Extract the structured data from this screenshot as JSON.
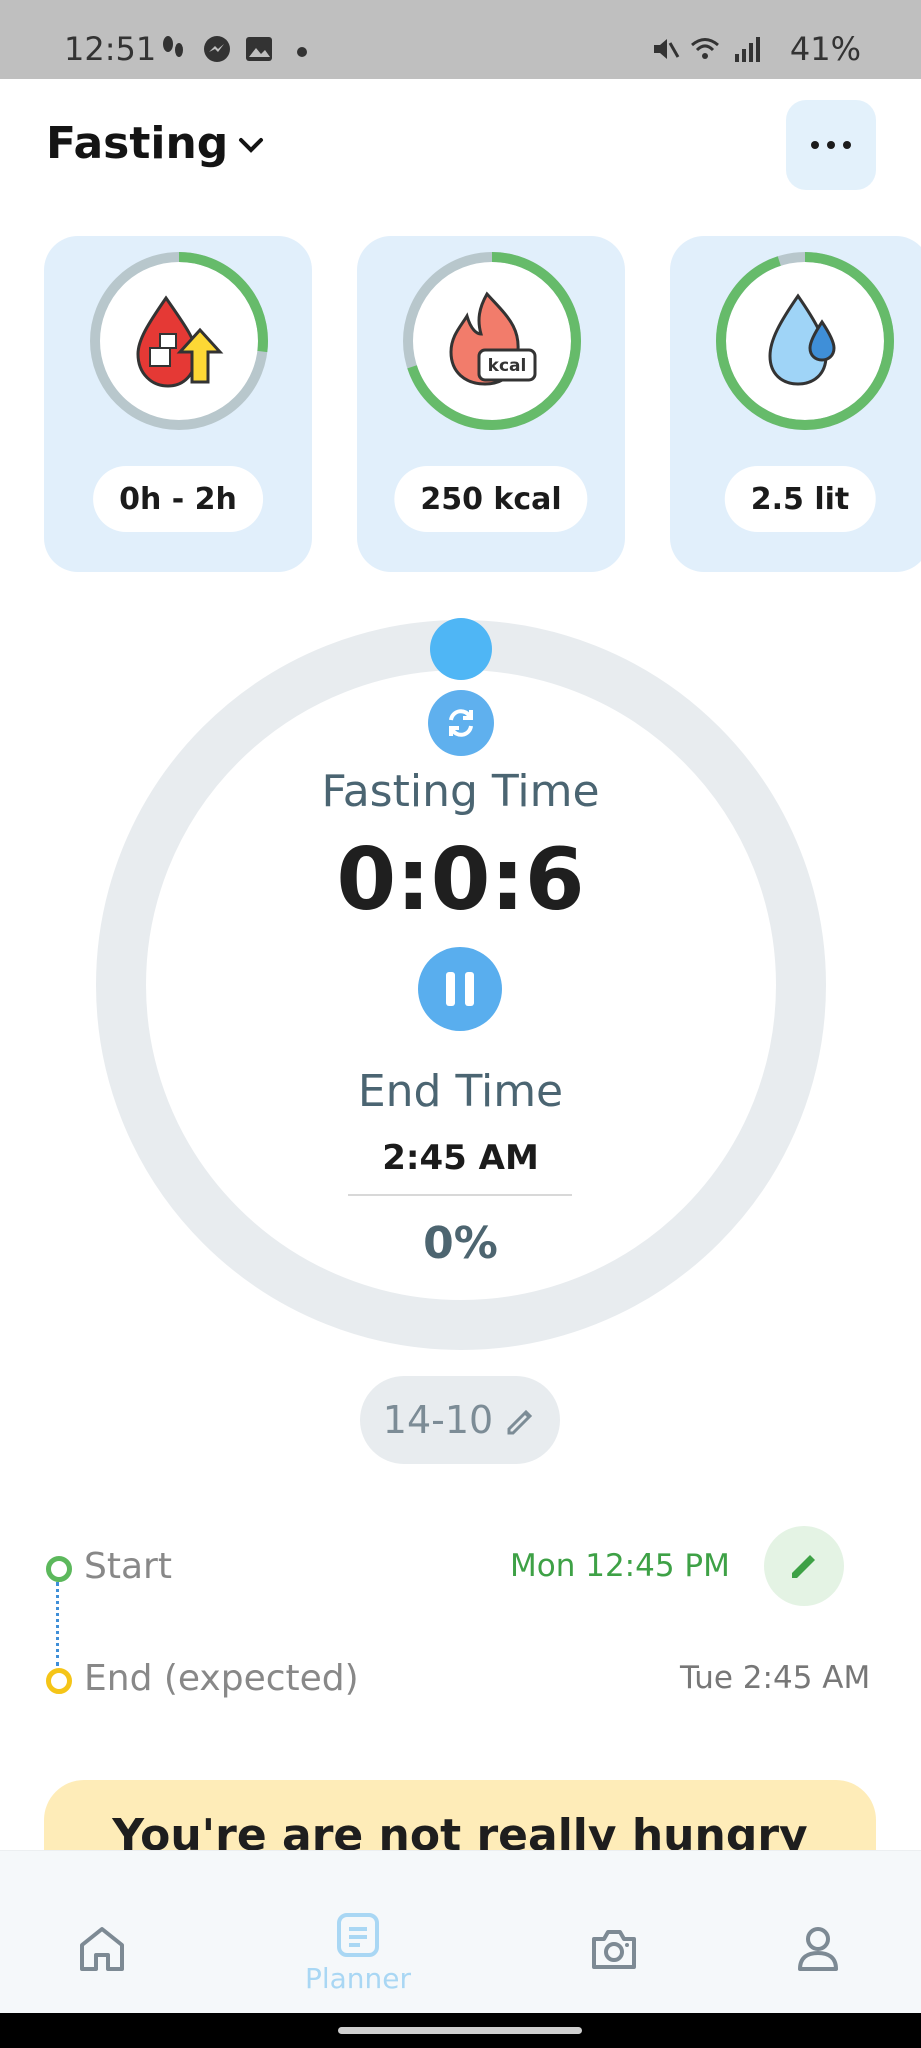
{
  "status_bar": {
    "time": "12:51",
    "battery": "41%"
  },
  "header": {
    "title": "Fasting"
  },
  "cards": [
    {
      "label": "0h - 2h",
      "progress": 0.27,
      "icon": "blood-sugar-icon"
    },
    {
      "label": "250 kcal",
      "progress": 0.7,
      "icon": "kcal-flame-icon"
    },
    {
      "label": "2.5 lit",
      "progress": 0.95,
      "icon": "water-drop-icon"
    }
  ],
  "timer": {
    "fasting_label": "Fasting Time",
    "fasting_time": "0:0:6",
    "end_label": "End Time",
    "end_time": "2:45 AM",
    "percent": "0%"
  },
  "plan": {
    "label": "14-10"
  },
  "schedule": {
    "start_label": "Start",
    "start_value": "Mon 12:45 PM",
    "end_label": "End (expected)",
    "end_value": "Tue 2:45 AM"
  },
  "banner": {
    "text": "You're are not really hungry"
  },
  "nav": {
    "planner_label": "Planner"
  },
  "colors": {
    "accent": "#59aeee",
    "progress_green": "#66bb6a",
    "banner_bg": "#feecb8"
  }
}
